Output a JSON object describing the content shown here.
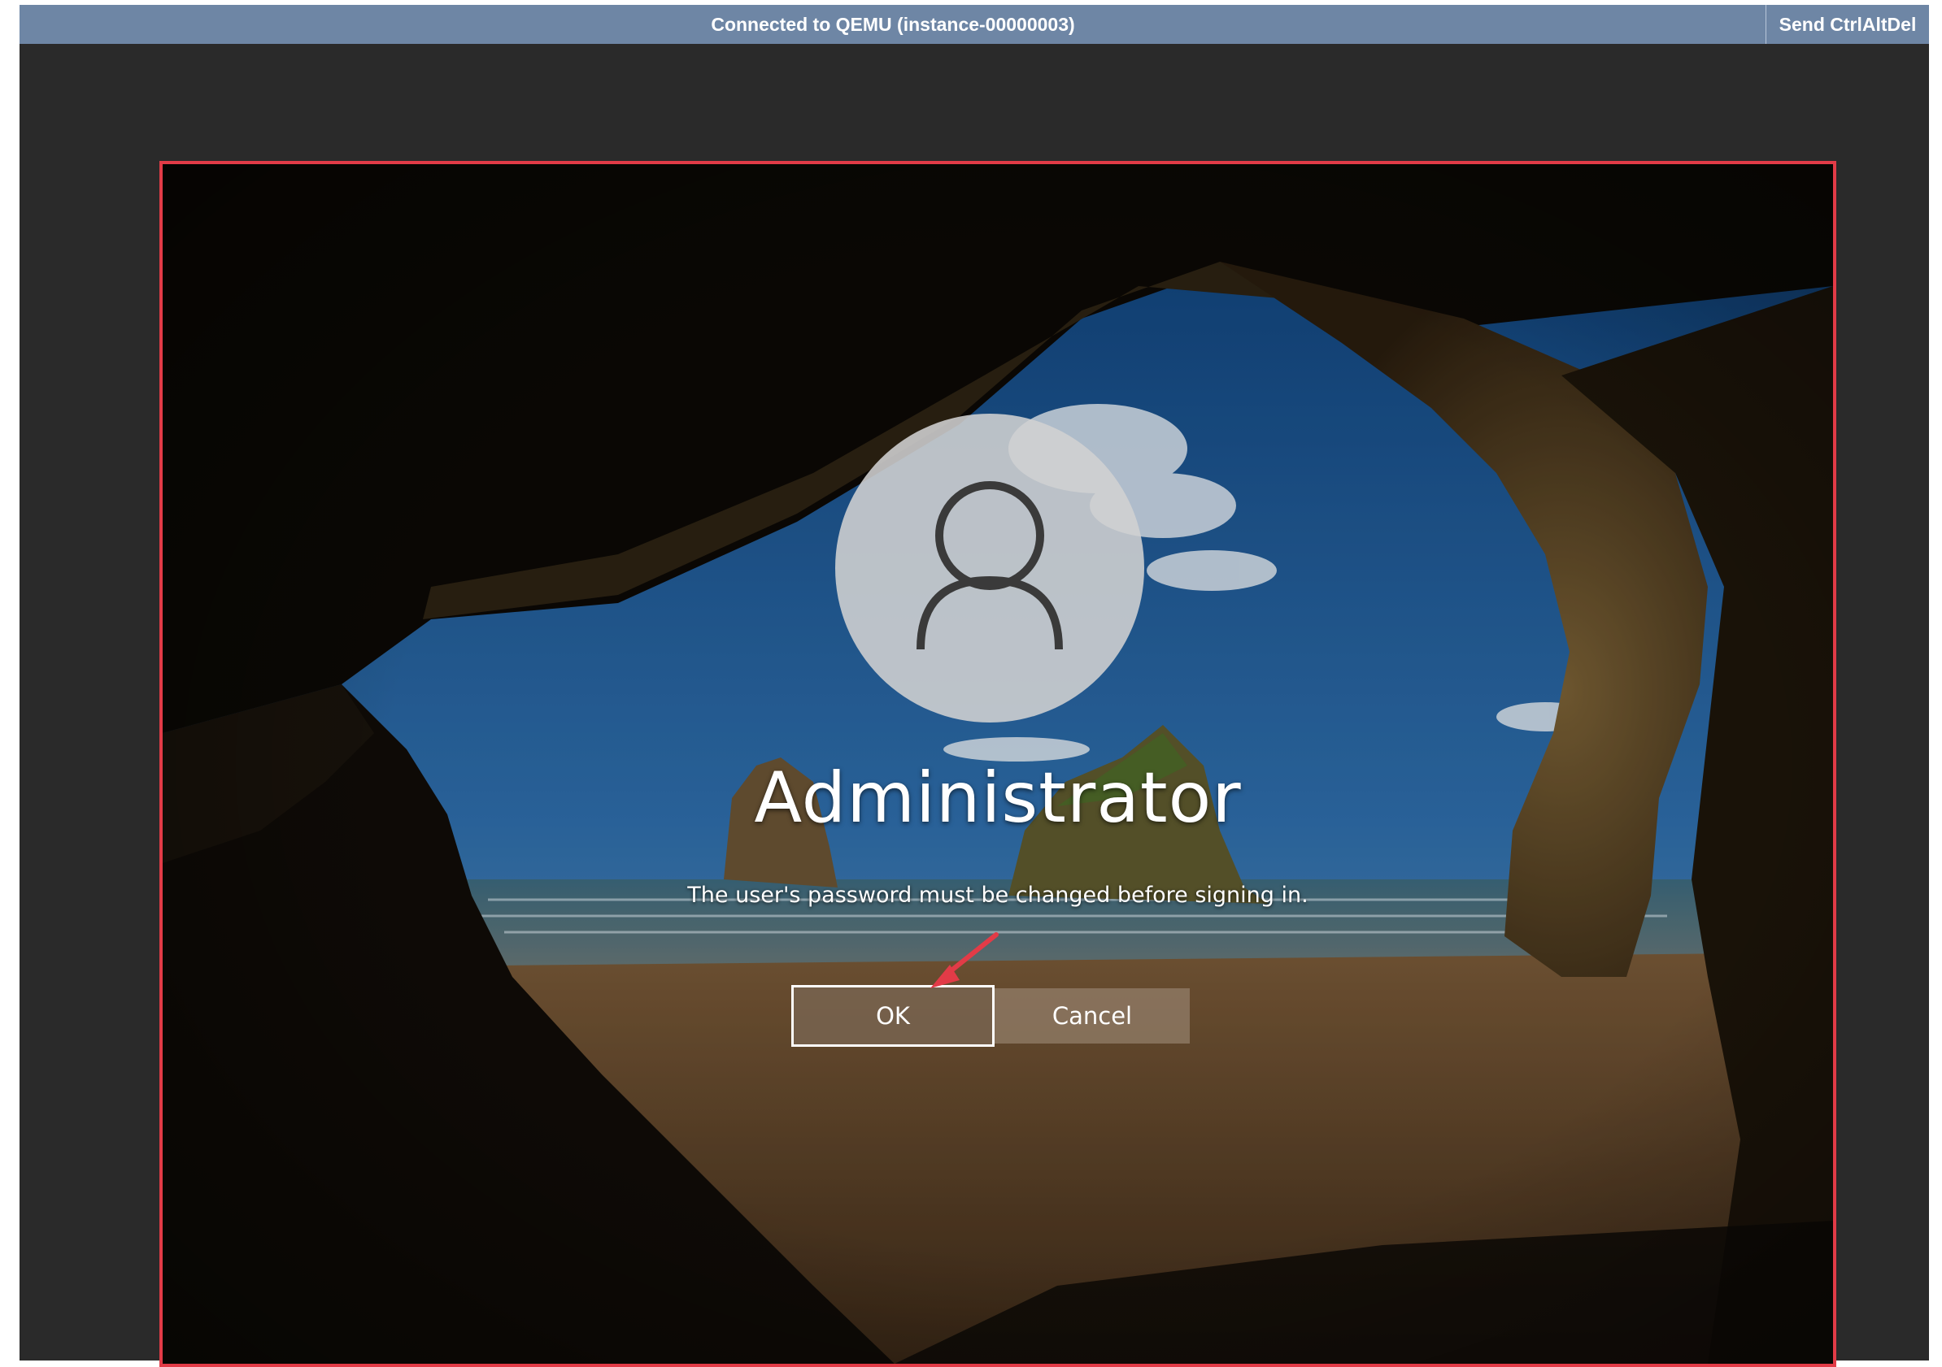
{
  "vnc": {
    "status": "Connected to QEMU (instance-00000003)",
    "send_ctrl_alt_del": "Send CtrlAltDel"
  },
  "login": {
    "username": "Administrator",
    "message": "The user's password must be changed before signing in.",
    "ok_label": "OK",
    "cancel_label": "Cancel"
  },
  "colors": {
    "status_bar": "#6e86a5",
    "highlight_border": "#e23b47",
    "annotation_arrow": "#e23b47"
  },
  "icons": {
    "avatar": "user-silhouette-icon",
    "annotation": "red-arrow-icon"
  }
}
